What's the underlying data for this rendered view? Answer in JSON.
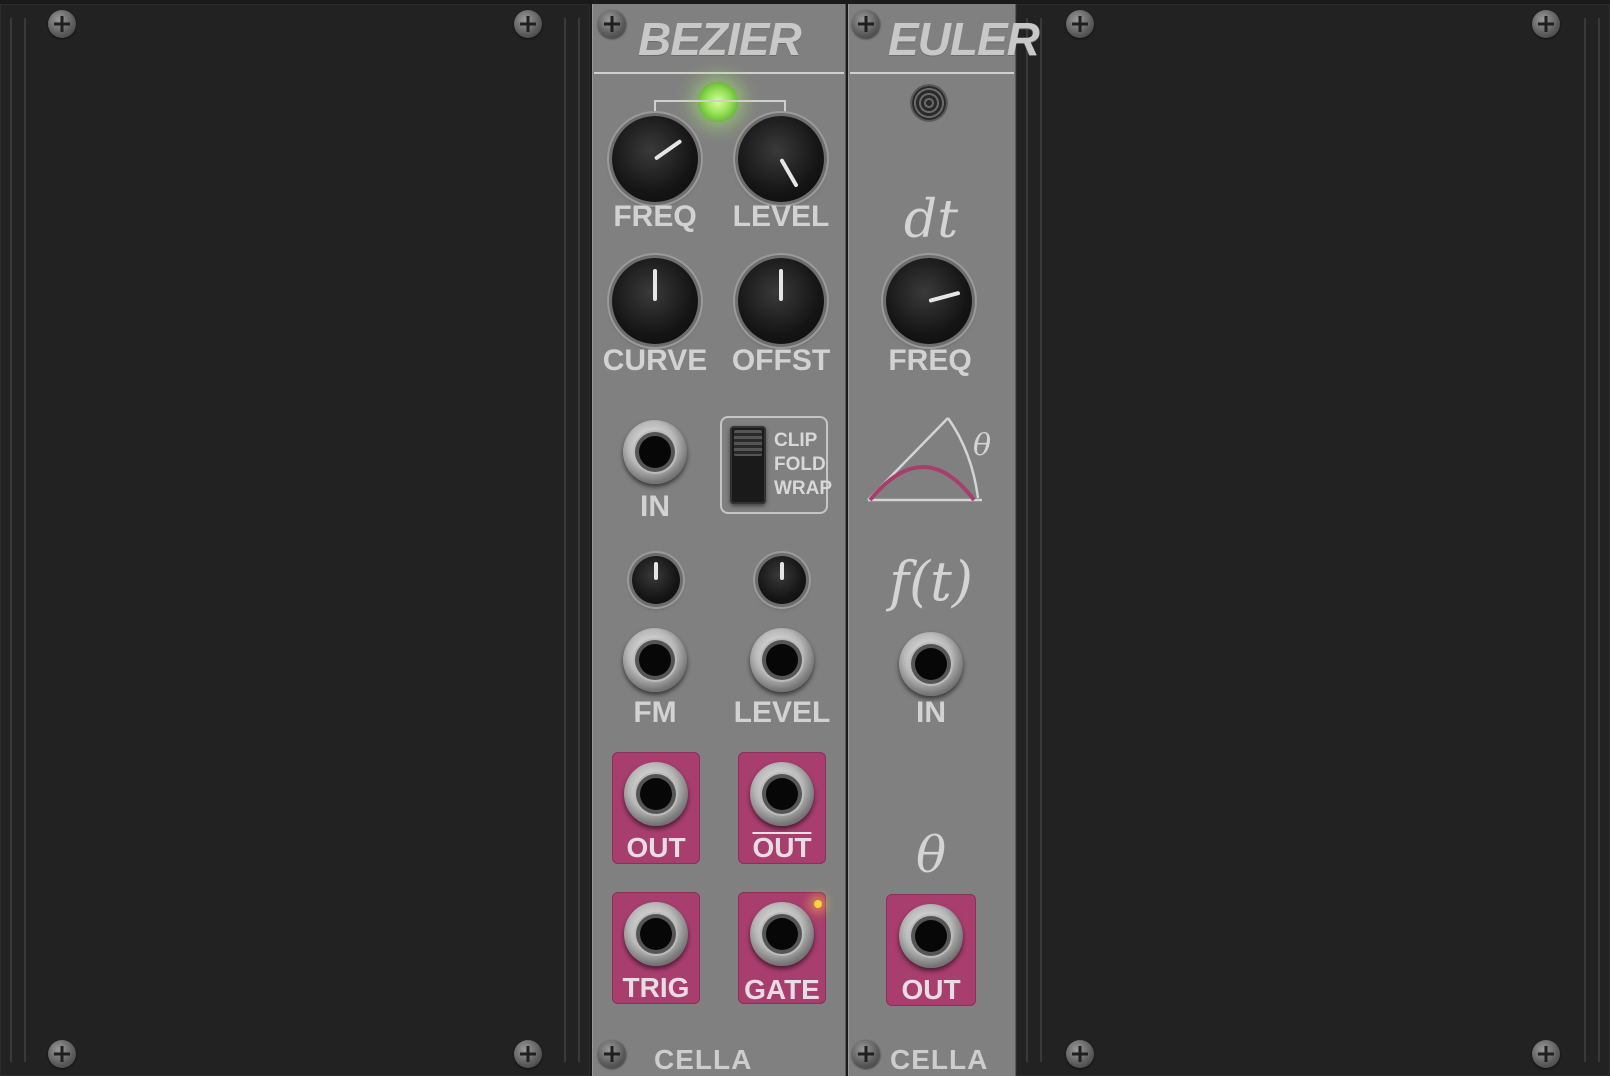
{
  "bezier": {
    "title": "BEZIER",
    "knobs": {
      "freq": "FREQ",
      "level": "LEVEL",
      "curve": "CURVE",
      "offset": "OFFST"
    },
    "switch": {
      "clip": "CLIP",
      "fold": "FOLD",
      "wrap": "WRAP"
    },
    "jacks": {
      "in": "IN",
      "fm": "FM",
      "level": "LEVEL"
    },
    "outputs": {
      "out": "OUT",
      "out_inverted": "OUT",
      "trig": "TRIG",
      "gate": "GATE"
    },
    "brand": "CELLA"
  },
  "euler": {
    "title": "EULER",
    "dt": "dt",
    "knobs": {
      "freq": "FREQ"
    },
    "theta_graph_label": "θ",
    "ft": "f(t)",
    "jacks": {
      "in": "IN"
    },
    "theta": "θ",
    "outputs": {
      "out": "OUT"
    },
    "brand": "CELLA"
  },
  "colors": {
    "panel": "#808080",
    "output_accent": "#a83e6e",
    "blank": "#222222",
    "led_green": "#9be35a",
    "led_yellow": "#ffd23a"
  }
}
